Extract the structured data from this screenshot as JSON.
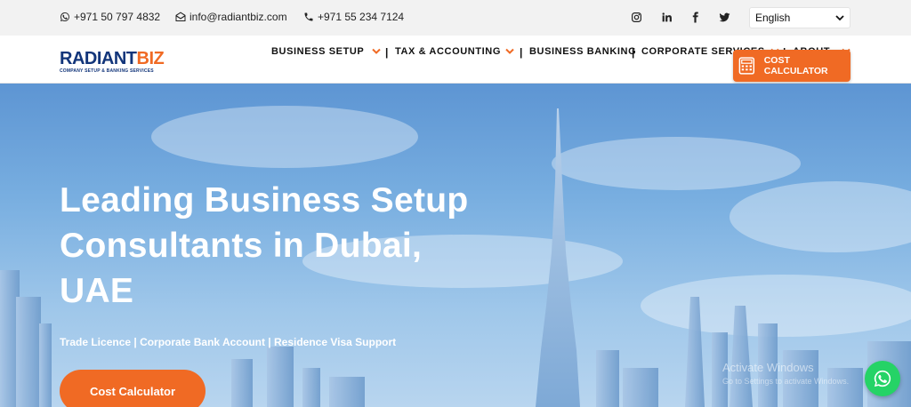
{
  "topbar": {
    "whatsapp_number": "+971 50 797 4832",
    "email": "info@radiantbiz.com",
    "phone": "+971 55 234 7124",
    "social": [
      "instagram-icon",
      "linkedin-icon",
      "facebook-icon",
      "twitter-icon"
    ],
    "language": "English"
  },
  "logo": {
    "part1": "RADIANT",
    "part2": "BIZ",
    "tagline": "COMPANY SETUP & BANKING SERVICES"
  },
  "nav": {
    "items": [
      {
        "label": "BUSINESS SETUP"
      },
      {
        "label": "TAX & ACCOUNTING"
      },
      {
        "label": "BUSINESS BANKING"
      },
      {
        "label": "CORPORATE SERVICES"
      },
      {
        "label": "ABOUT"
      }
    ],
    "separator": "|",
    "cost_calculator": "COST CALCULATOR"
  },
  "hero": {
    "title": "Leading Business Setup Consultants in Dubai, UAE",
    "subtitle": "Trade Licence | Corporate Bank Account | Residence Visa Support",
    "button": "Cost Calculator"
  },
  "overlay": {
    "watermark_title": "Activate Windows",
    "watermark_text": "Go to Settings to activate Windows."
  },
  "colors": {
    "brand_orange": "#f06a24",
    "brand_navy": "#12357a",
    "whatsapp_green": "#25d366"
  }
}
